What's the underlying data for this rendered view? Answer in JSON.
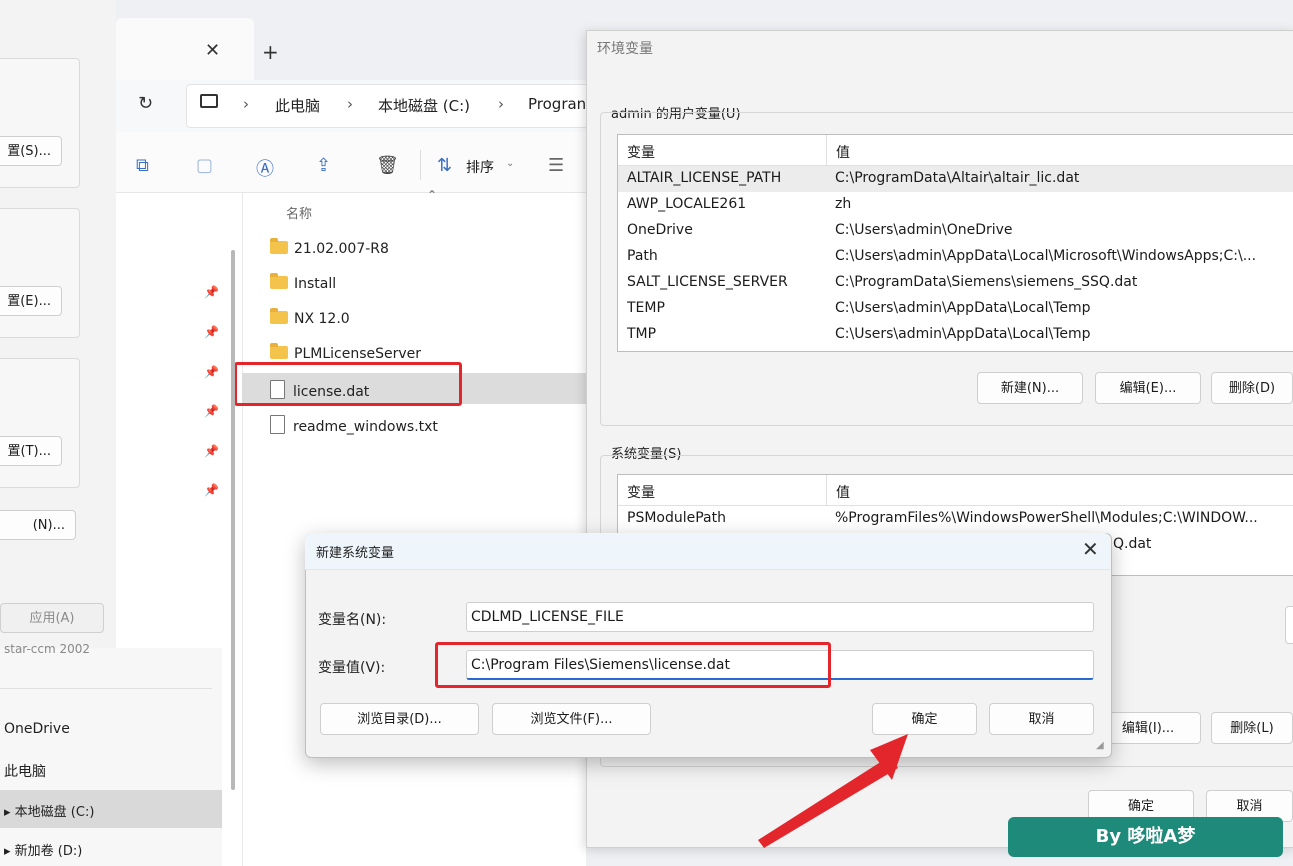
{
  "explorer": {
    "address": [
      "此电脑",
      "本地磁盘 (C:)",
      "Progran"
    ],
    "toolbar": {
      "sort_label": "排序"
    },
    "column_name": "名称",
    "files": [
      {
        "name": "21.02.007-R8",
        "type": "folder"
      },
      {
        "name": "Install",
        "type": "folder"
      },
      {
        "name": "NX 12.0",
        "type": "folder"
      },
      {
        "name": "PLMLicenseServer",
        "type": "folder"
      },
      {
        "name": "license.dat",
        "type": "file"
      },
      {
        "name": "readme_windows.txt",
        "type": "file"
      }
    ],
    "nav_items": [
      "star-ccm 2002",
      "OneDrive",
      "此电脑",
      "本地磁盘 (C:)",
      "新加卷 (D:)"
    ]
  },
  "left_panel": {
    "buttons": [
      "置(S)...",
      "置(E)...",
      "置(T)...",
      "(N)...",
      "应用(A)"
    ]
  },
  "env_window": {
    "title": "环境变量",
    "user_section": "admin 的用户变量(U)",
    "system_section": "系统变量(S)",
    "col_var": "变量",
    "col_val": "值",
    "user_vars": [
      {
        "name": "ALTAIR_LICENSE_PATH",
        "value": "C:\\ProgramData\\Altair\\altair_lic.dat"
      },
      {
        "name": "AWP_LOCALE261",
        "value": "zh"
      },
      {
        "name": "OneDrive",
        "value": "C:\\Users\\admin\\OneDrive"
      },
      {
        "name": "Path",
        "value": "C:\\Users\\admin\\AppData\\Local\\Microsoft\\WindowsApps;C:\\..."
      },
      {
        "name": "SALT_LICENSE_SERVER",
        "value": "C:\\ProgramData\\Siemens\\siemens_SSQ.dat"
      },
      {
        "name": "TEMP",
        "value": "C:\\Users\\admin\\AppData\\Local\\Temp"
      },
      {
        "name": "TMP",
        "value": "C:\\Users\\admin\\AppData\\Local\\Temp"
      }
    ],
    "system_vars": [
      {
        "name": "PSModulePath",
        "value": "%ProgramFiles%\\WindowsPowerShell\\Modules;C:\\WINDOW..."
      },
      {
        "name": "",
        "value": "Q.dat"
      }
    ],
    "user_buttons": {
      "new": "新建(N)...",
      "edit": "编辑(E)...",
      "delete": "删除(D)"
    },
    "system_buttons": {
      "edit": "编辑(I)...",
      "delete": "删除(L)"
    },
    "ok": "确定",
    "cancel": "取消"
  },
  "dialog": {
    "title": "新建系统变量",
    "name_label": "变量名(N):",
    "value_label": "变量值(V):",
    "name_value": "CDLMD_LICENSE_FILE",
    "value_value": "C:\\Program Files\\Siemens\\license.dat",
    "browse_dir": "浏览目录(D)...",
    "browse_file": "浏览文件(F)...",
    "ok": "确定",
    "cancel": "取消"
  },
  "watermark": "By 哆啦A梦",
  "colors": {
    "accent_red": "#e3262c",
    "watermark_bg": "#1e8a7a",
    "focus_blue": "#2a6bd1"
  }
}
